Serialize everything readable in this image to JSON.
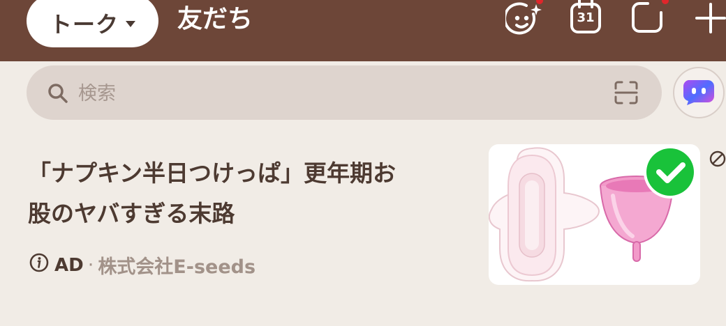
{
  "header": {
    "talk_tab_label": "トーク",
    "friends_tab_label": "友だち",
    "calendar_day": "31",
    "icons": [
      "face-sparkle-icon",
      "calendar-icon",
      "chat-bubble-icon",
      "plus-icon"
    ],
    "notification_color": "#e0262b",
    "background_color": "#6d4638"
  },
  "search": {
    "placeholder": "検索",
    "value": ""
  },
  "ad": {
    "title_line1": "「ナプキン半日つけっぱ」更年期お",
    "title_line2": "股のヤバすぎる末路",
    "ad_label": "AD",
    "separator": "·",
    "sponsor": "株式会社E-seeds"
  },
  "colors": {
    "page_background": "#f1ece6",
    "search_background": "#ded4ce",
    "title_text": "#4d3a31",
    "meta_text": "#a29289",
    "check_badge": "#19c23a"
  }
}
